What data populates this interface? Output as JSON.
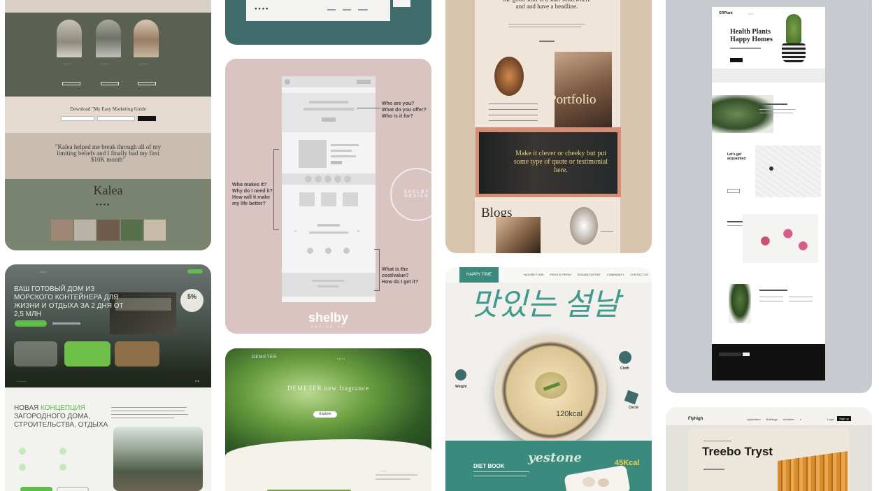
{
  "kalea": {
    "guide_cta": "Download \"My Easy Marketing Guide",
    "testimonial": "\"Kalea helped me break through all of my limiting beliefs and I finally had my first $10K month\"",
    "logo": "Kalea"
  },
  "russian_house": {
    "hero_title": "ВАШ ГОТОВЫЙ ДОМ ИЗ МОРСКОГО КОНТЕЙНЕРА ДЛЯ ЖИЗНИ И ОТДЫХА ЗА 2 ДНЯ ОТ 2,5 МЛН",
    "badge": "5%",
    "concept_title_1": "НОВАЯ ",
    "concept_title_accent": "КОНЦЕПЦИЯ",
    "concept_title_2": " ЗАГОРОДНОГО ДОМА, СТРОИТЕЛЬСТВА, ОТДЫХА"
  },
  "shelby": {
    "ann_top": [
      "Who are you?",
      "What do you offer?",
      "Who is it for?"
    ],
    "ann_left": [
      "Who makes it?",
      "Why do I need it?",
      "How will it make",
      "my life better?"
    ],
    "ann_bottom": [
      "What is the cost/value?",
      "How do I get it?"
    ],
    "logo": "shelby",
    "logo_sub": "DESIGN CO",
    "stamp": "SHELBY DESIGN"
  },
  "palm": {
    "brand": "DEMETER",
    "headline": "DEMETER new fragrance",
    "cta": "Explore"
  },
  "portfolio": {
    "headline": "the good stuff is a start somewhere and and have a headline.",
    "portfolio_title": "Portfolio",
    "quote": "Make it clever or cheeky but put some type of quote or testimonial here.",
    "blogs_title": "Blogs"
  },
  "korean": {
    "brand": "HAPPY TIME",
    "nav": [
      "NATURE FOOD",
      "FRUIT & FRESH",
      "SUGARCONTENT",
      "COMMUNITY",
      "CONTACT US"
    ],
    "title_glyphs": "맛있는 설날",
    "kcal_bowl": "120kcal",
    "kcal_dessert": "45Kcal",
    "diet_book": "DIET BOOK",
    "script": "yestone",
    "side_labels": [
      "Cloth",
      "Circle",
      "Weight"
    ]
  },
  "plants": {
    "brand": "GRPlant",
    "headline": "Health Plants Happy Homes",
    "section_title": "Let's get acquainted"
  },
  "treebo": {
    "brand": "Flyhigh",
    "nav": [
      "Application",
      "Buildings",
      "Activities"
    ],
    "login": "Login",
    "signup": "Sign up",
    "title": "Treebo Tryst"
  },
  "colors": {
    "kalea_green": "#5b6152",
    "shelby_pink": "#d9c4c2",
    "teal": "#3f6b6a",
    "korean_teal": "#3a8a7d",
    "portfolio_beige": "#d9c5ad",
    "plants_grey": "#c7cbcf"
  }
}
